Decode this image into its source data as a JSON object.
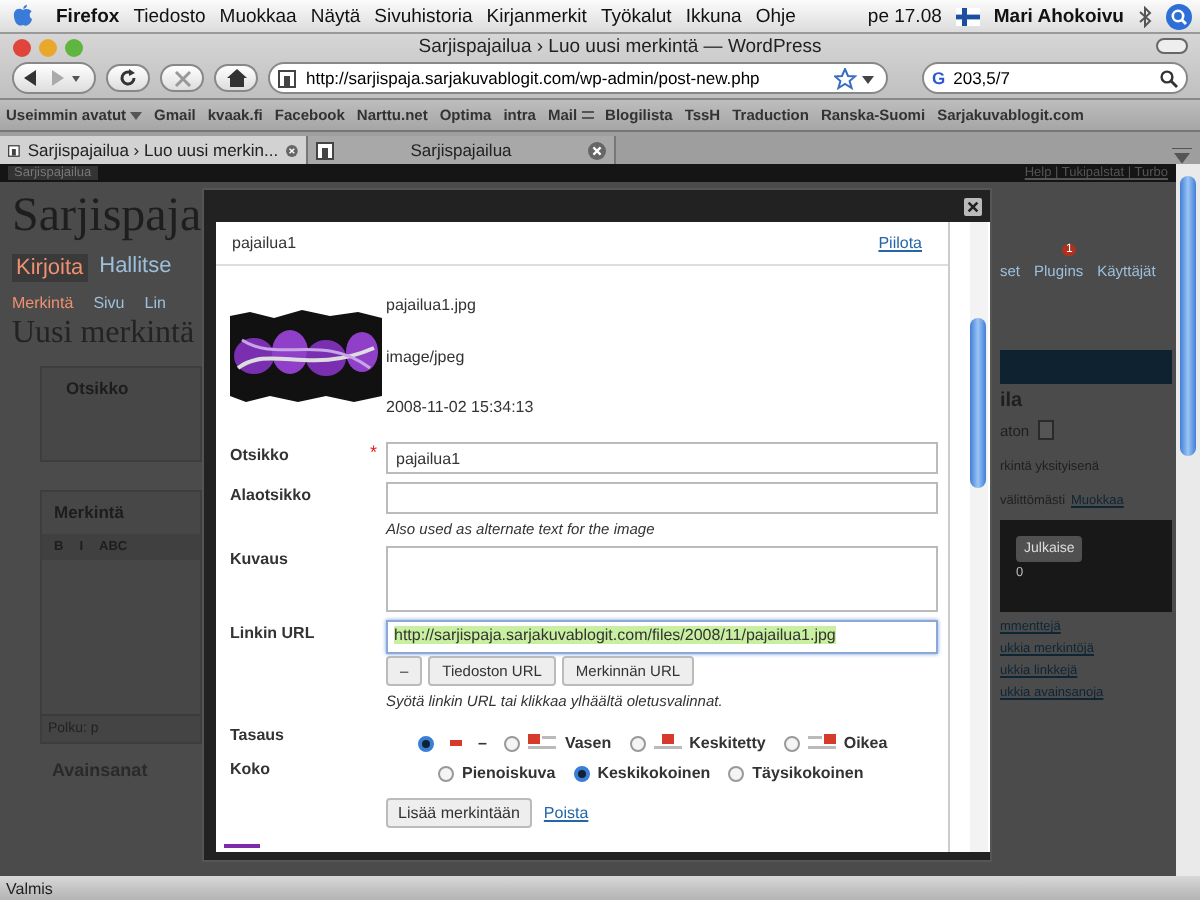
{
  "menubar": {
    "app": "Firefox",
    "items": [
      "Tiedosto",
      "Muokkaa",
      "Näytä",
      "Sivuhistoria",
      "Kirjanmerkit",
      "Työkalut",
      "Ikkuna",
      "Ohje"
    ],
    "clock": "pe 17.08",
    "user": "Mari Ahokoivu"
  },
  "window": {
    "title": "Sarjispajailua › Luo uusi merkintä — WordPress"
  },
  "toolbar": {
    "url": "http://sarjispaja.sarjakuvablogit.com/wp-admin/post-new.php",
    "search": "203,5/7",
    "engine": "G"
  },
  "bookmarks": [
    {
      "label": "Useimmin avatut",
      "kind": "menu"
    },
    {
      "label": "Gmail",
      "kind": "link"
    },
    {
      "label": "kvaak.fi",
      "kind": "link"
    },
    {
      "label": "Facebook",
      "kind": "link"
    },
    {
      "label": "Narttu.net",
      "kind": "link"
    },
    {
      "label": "Optima",
      "kind": "link"
    },
    {
      "label": "intra",
      "kind": "link"
    },
    {
      "label": "Mail",
      "kind": "folder"
    },
    {
      "label": "Blogilista",
      "kind": "link"
    },
    {
      "label": "TssH",
      "kind": "link"
    },
    {
      "label": "Traduction",
      "kind": "link"
    },
    {
      "label": "Ranska-Suomi",
      "kind": "link"
    },
    {
      "label": "Sarjakuvablogit.com",
      "kind": "link"
    }
  ],
  "tabs": [
    {
      "label": "Sarjispajailua › Luo uusi merkin...",
      "selected": true
    },
    {
      "label": "Sarjispajailua",
      "selected": false
    }
  ],
  "background": {
    "site_tab": "Sarjispajailua",
    "top_links": "Help | Tukipalstat | Turbo",
    "site_title": "Sarjispaja",
    "nav": [
      {
        "label": "Kirjoita",
        "selected": true
      },
      {
        "label": "Hallitse",
        "selected": false
      }
    ],
    "subnav": [
      {
        "label": "Merkintä",
        "selected": true
      },
      {
        "label": "Sivu",
        "selected": false
      },
      {
        "label": "Lin",
        "selected": false
      }
    ],
    "heading": "Uusi merkintä",
    "boxes": [
      "Otsikko",
      "Merkintä"
    ],
    "editor_buttons": [
      "B",
      "I",
      "ABC"
    ],
    "path": "Polku: p",
    "keywords": "Avainsanat",
    "right_nav": [
      "set",
      "Plugins",
      "Käyttäjät"
    ],
    "plugins_badge": "1",
    "status_title": "ila",
    "status_select": "aton",
    "private": "rkintä yksityisenä",
    "publish_time": "välittömästi",
    "edit": "Muokkaa",
    "publish": "Julkaise",
    "count": "0",
    "links": [
      "mmenttejä",
      "ukkia merkintöjä",
      "ukkia linkkejä",
      "ukkia avainsanoja"
    ]
  },
  "dialog": {
    "header": {
      "title": "pajailua1",
      "hide_link": "Piilota"
    },
    "file": {
      "name": "pajailua1.jpg",
      "type": "image/jpeg",
      "date": "2008-11-02 15:34:13"
    },
    "fields": [
      {
        "kind": "input",
        "label": "Otsikko",
        "required_mark": "*",
        "value": "pajailua1"
      },
      {
        "kind": "input",
        "label": "Alaotsikko",
        "help": "Also used as alternate text for the image"
      },
      {
        "kind": "textarea",
        "label": "Kuvaus"
      },
      {
        "kind": "url",
        "label": "Linkin URL",
        "value": "http://sarjispaja.sarjakuvablogit.com/files/2008/11/pajailua1.jpg",
        "buttons": [
          "–",
          "Tiedoston URL",
          "Merkinnän URL"
        ],
        "help": "Syötä linkin URL tai klikkaa ylhäältä oletusvalinnat."
      }
    ],
    "align": {
      "label": "Tasaus",
      "options": [
        {
          "label": "–",
          "kind": "none",
          "selected": true
        },
        {
          "label": "Vasen",
          "kind": "left",
          "selected": false
        },
        {
          "label": "Keskitetty",
          "kind": "center",
          "selected": false
        },
        {
          "label": "Oikea",
          "kind": "right",
          "selected": false
        }
      ]
    },
    "size": {
      "label": "Koko",
      "options": [
        {
          "label": "Pienoiskuva",
          "selected": false
        },
        {
          "label": "Keskikokoinen",
          "selected": true
        },
        {
          "label": "Täysikokoinen",
          "selected": false
        }
      ]
    },
    "insert_button": "Lisää merkintään",
    "delete_link": "Poista"
  },
  "status_bar": "Valmis"
}
